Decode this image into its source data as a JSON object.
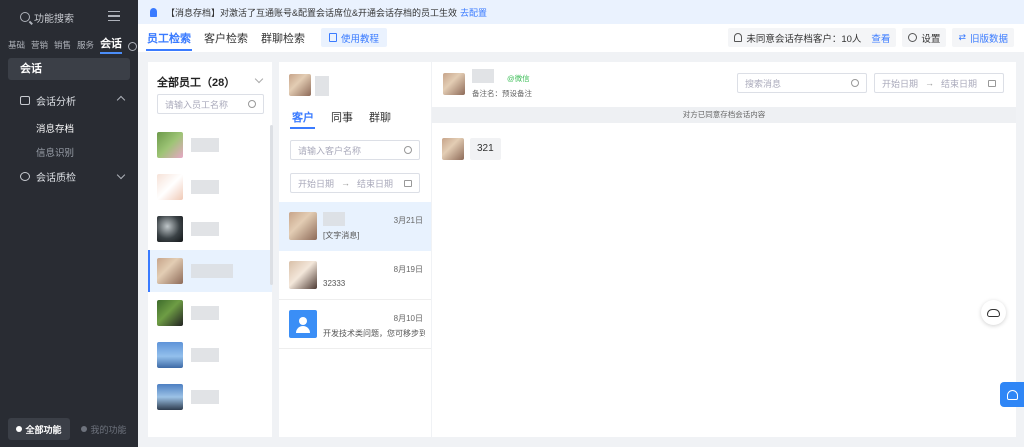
{
  "sidebar": {
    "search_label": "功能搜索",
    "tabs": [
      "基础",
      "营销",
      "销售",
      "服务",
      "会话"
    ],
    "section_label": "会话",
    "groups": [
      {
        "label": "会话分析",
        "items": [
          "消息存档",
          "信息识别"
        ]
      },
      {
        "label": "会话质检"
      }
    ],
    "all_functions": "全部功能",
    "my_functions": "我的功能"
  },
  "notice": {
    "text": "【消息存档】对激活了互通账号&配置会话席位&开通会话存档的员工生效",
    "link": "去配置"
  },
  "header": {
    "tabs": [
      "员工检索",
      "客户检索",
      "群聊检索"
    ],
    "tutorial": "使用教程",
    "unagreed_label": "未同意会话存档客户：10人",
    "view": "查看",
    "settings": "设置",
    "old_data": "旧版数据"
  },
  "employees": {
    "title": "全部员工（28）",
    "search_placeholder": "请输入员工名称"
  },
  "chat_list": {
    "tabs": [
      "客户",
      "同事",
      "群聊"
    ],
    "search_placeholder": "请输入客户名称",
    "date_start": "开始日期",
    "date_end": "结束日期",
    "items": [
      {
        "date": "3月21日",
        "message": "[文字消息]"
      },
      {
        "date": "8月19日",
        "message": "32333"
      },
      {
        "date": "8月10日",
        "message": "开发技术类问题，您可移步到..."
      }
    ]
  },
  "message_panel": {
    "wechat_tag": "@微信",
    "remark": "备注名：预设备注",
    "search_placeholder": "搜索消息",
    "date_start": "开始日期",
    "date_end": "结束日期",
    "separator": "对方已同意存档会话内容",
    "messages": [
      {
        "text": "321"
      }
    ]
  },
  "colors": {
    "primary": "#3a7bff",
    "sidebar_bg": "#292c33",
    "notice_bg": "#eaf2fe",
    "selected_row_bg": "#e8f2fe",
    "wechat_green": "#3fbf5a"
  }
}
